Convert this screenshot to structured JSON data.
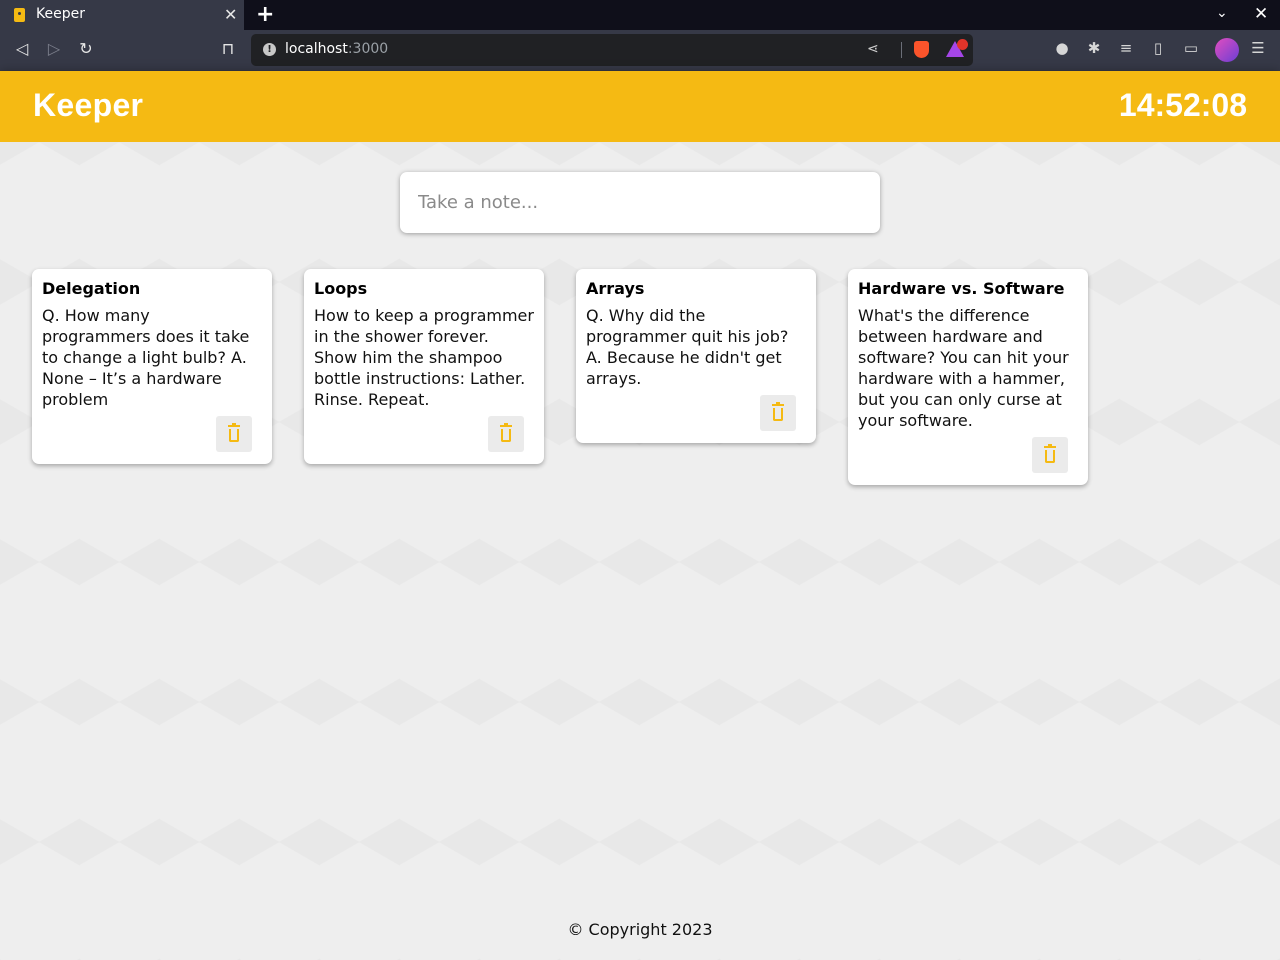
{
  "browser": {
    "tab_title": "Keeper",
    "tab_close": "✕",
    "new_tab": "+",
    "url_host": "localhost",
    "url_port": ":3000"
  },
  "header": {
    "title": "Keeper",
    "clock": "14:52:08"
  },
  "create": {
    "placeholder": "Take a note..."
  },
  "notes": [
    {
      "title": "Delegation",
      "content": "Q. How many programmers does it take to change a light bulb? A. None – It’s a hardware problem"
    },
    {
      "title": "Loops",
      "content": "How to keep a programmer in the shower forever. Show him the shampoo bottle instructions: Lather. Rinse. Repeat."
    },
    {
      "title": "Arrays",
      "content": "Q. Why did the programmer quit his job? A. Because he didn't get arrays."
    },
    {
      "title": "Hardware vs. Software",
      "content": "What's the difference between hardware and software? You can hit your hardware with a hammer, but you can only curse at your software."
    }
  ],
  "footer": {
    "text": "© Copyright 2023"
  },
  "colors": {
    "accent": "#f5ba13",
    "background": "#eeeeee",
    "chrome": "#363947"
  },
  "icons": [
    "back-icon",
    "forward-icon",
    "reload-icon",
    "bookmark-icon",
    "info-icon",
    "share-icon",
    "brave-shield-icon",
    "brave-rewards-icon",
    "extensions-icon",
    "playlist-icon",
    "sidebar-icon",
    "wallet-icon",
    "menu-icon",
    "trash-icon"
  ]
}
